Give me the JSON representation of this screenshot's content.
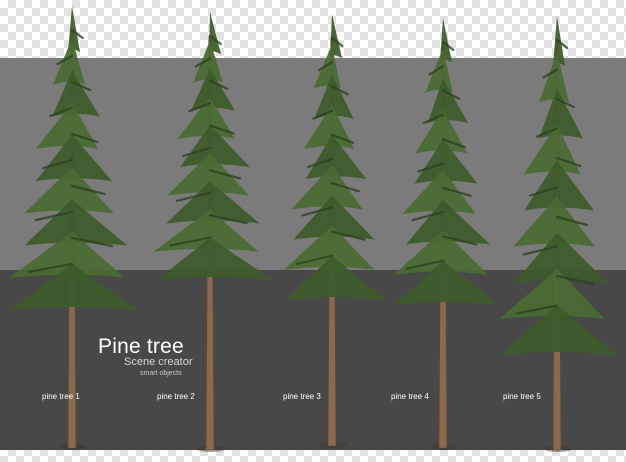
{
  "title": "Pine tree",
  "subtitle": "Scene creator",
  "tagline": "smart objects",
  "trees": [
    {
      "label": "pine tree 1"
    },
    {
      "label": "pine tree 2"
    },
    {
      "label": "pine tree 3"
    },
    {
      "label": "pine tree 4"
    },
    {
      "label": "pine tree 5"
    }
  ],
  "colors": {
    "light_band": "#7b7b7b",
    "dark_band": "#484848",
    "foliage": "#3d5a2a",
    "trunk": "#8a6a4e",
    "text": "#ffffff"
  }
}
